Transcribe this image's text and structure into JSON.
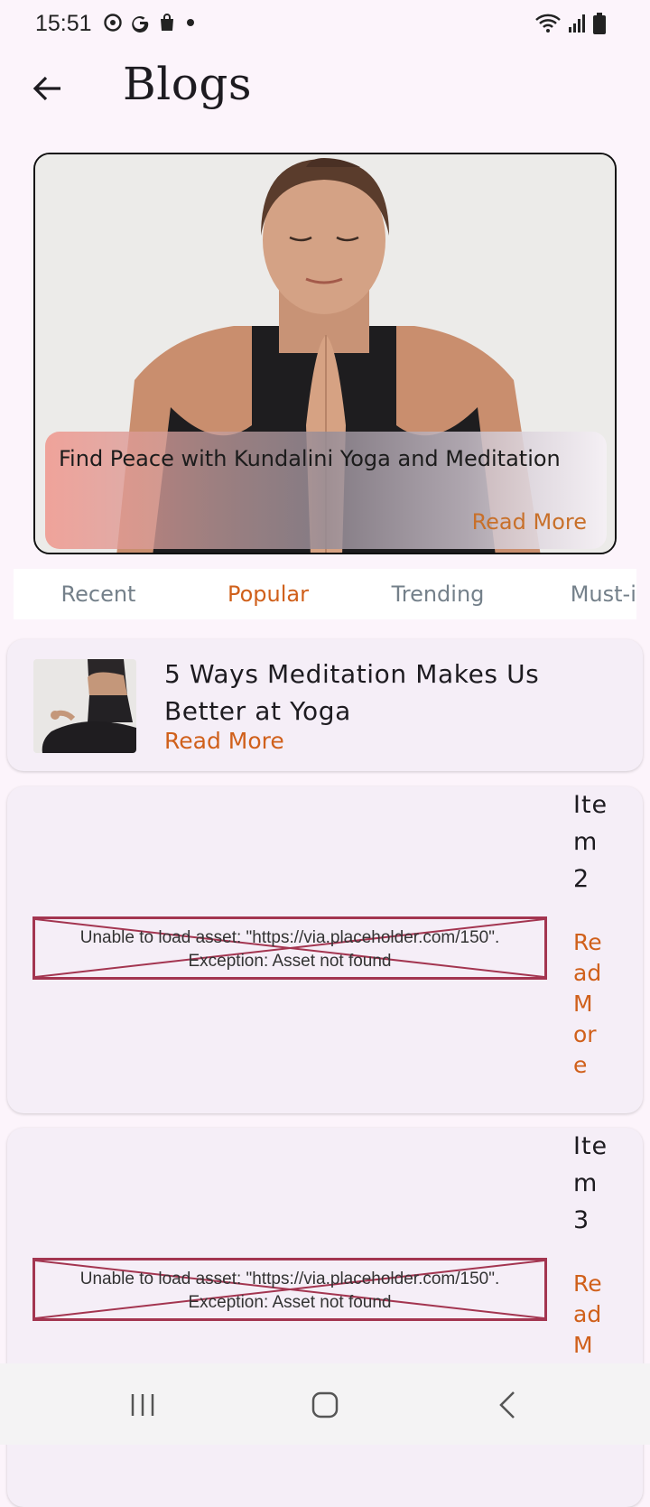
{
  "status_bar": {
    "time": "15:51"
  },
  "app_bar": {
    "title": "Blogs"
  },
  "hero": {
    "title": "Find Peace with Kundalini Yoga and Meditation",
    "read_more": "Read More"
  },
  "tabs": [
    {
      "label": "Recent",
      "active": false
    },
    {
      "label": "Popular",
      "active": true
    },
    {
      "label": "Trending",
      "active": false
    },
    {
      "label": "Must-it",
      "active": false
    }
  ],
  "posts": [
    {
      "title": "5 Ways Meditation Makes Us Better at Yoga",
      "read_more": "Read More"
    },
    {
      "title": "Item 2",
      "read_more": "Read More",
      "image_error": "Unable to load asset: \"https://via.placeholder.com/150\".\nException: Asset not found"
    },
    {
      "title": "Item 3",
      "read_more": "Read More",
      "image_error": "Unable to load asset: \"https://via.placeholder.com/150\".\nException: Asset not found"
    }
  ],
  "colors": {
    "accent": "#d0601b",
    "background": "#fcf4fb",
    "error": "#a33550"
  }
}
